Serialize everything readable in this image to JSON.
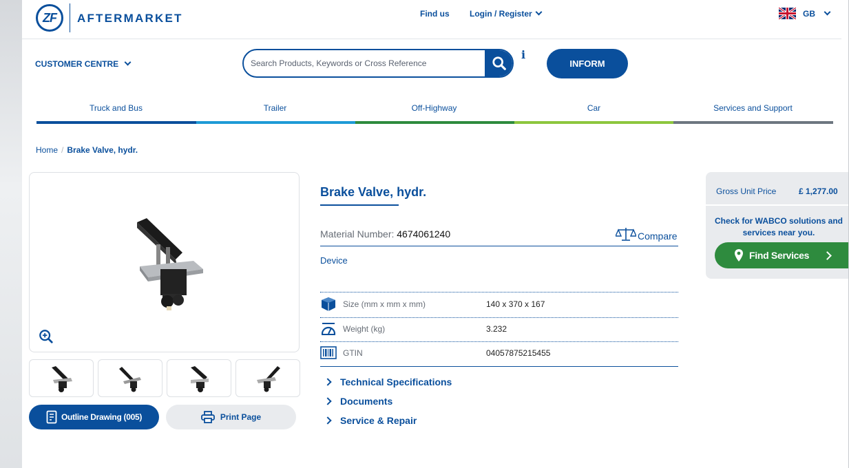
{
  "header": {
    "logo_mark": "ZF",
    "logo_text": "AFTERMARKET",
    "find_us": "Find us",
    "login": "Login / Register",
    "region": "GB",
    "customer_centre": "CUSTOMER CENTRE",
    "search_placeholder": "Search Products, Keywords or Cross Reference",
    "info_glyph": "i",
    "inform": "INFORM"
  },
  "nav": {
    "items": [
      {
        "label": "Truck and Bus",
        "color": "#0a4f9c"
      },
      {
        "label": "Trailer",
        "color": "#1e9ad6"
      },
      {
        "label": "Off-Highway",
        "color": "#2e8b3e"
      },
      {
        "label": "Car",
        "color": "#8cc63e"
      },
      {
        "label": "Services and Support",
        "color": "#6d7680"
      }
    ]
  },
  "breadcrumb": {
    "home": "Home",
    "separator": "/",
    "current": "Brake Valve, hydr."
  },
  "product": {
    "title": "Brake Valve, hydr.",
    "material_label": "Material Number:",
    "material_number": "4674061240",
    "compare": "Compare",
    "category": "Device",
    "specs": [
      {
        "icon": "box-icon",
        "label": "Size (mm x mm x mm)",
        "value": "140 x 370 x 167"
      },
      {
        "icon": "weight-icon",
        "label": "Weight (kg)",
        "value": "3.232"
      },
      {
        "icon": "barcode-icon",
        "label": "GTIN",
        "value": "04057875215455"
      }
    ],
    "sections": [
      "Technical Specifications",
      "Documents",
      "Service & Repair"
    ]
  },
  "media": {
    "outline_drawing": "Outline Drawing (005)",
    "print_page": "Print Page"
  },
  "pricing": {
    "label": "Gross Unit Price",
    "value": "£ 1,277.00",
    "wabco_text": "Check for WABCO solutions and services near you.",
    "find_services": "Find Services"
  },
  "colors": {
    "brand_blue": "#0a4f9c",
    "service_green": "#2e8b3e"
  }
}
